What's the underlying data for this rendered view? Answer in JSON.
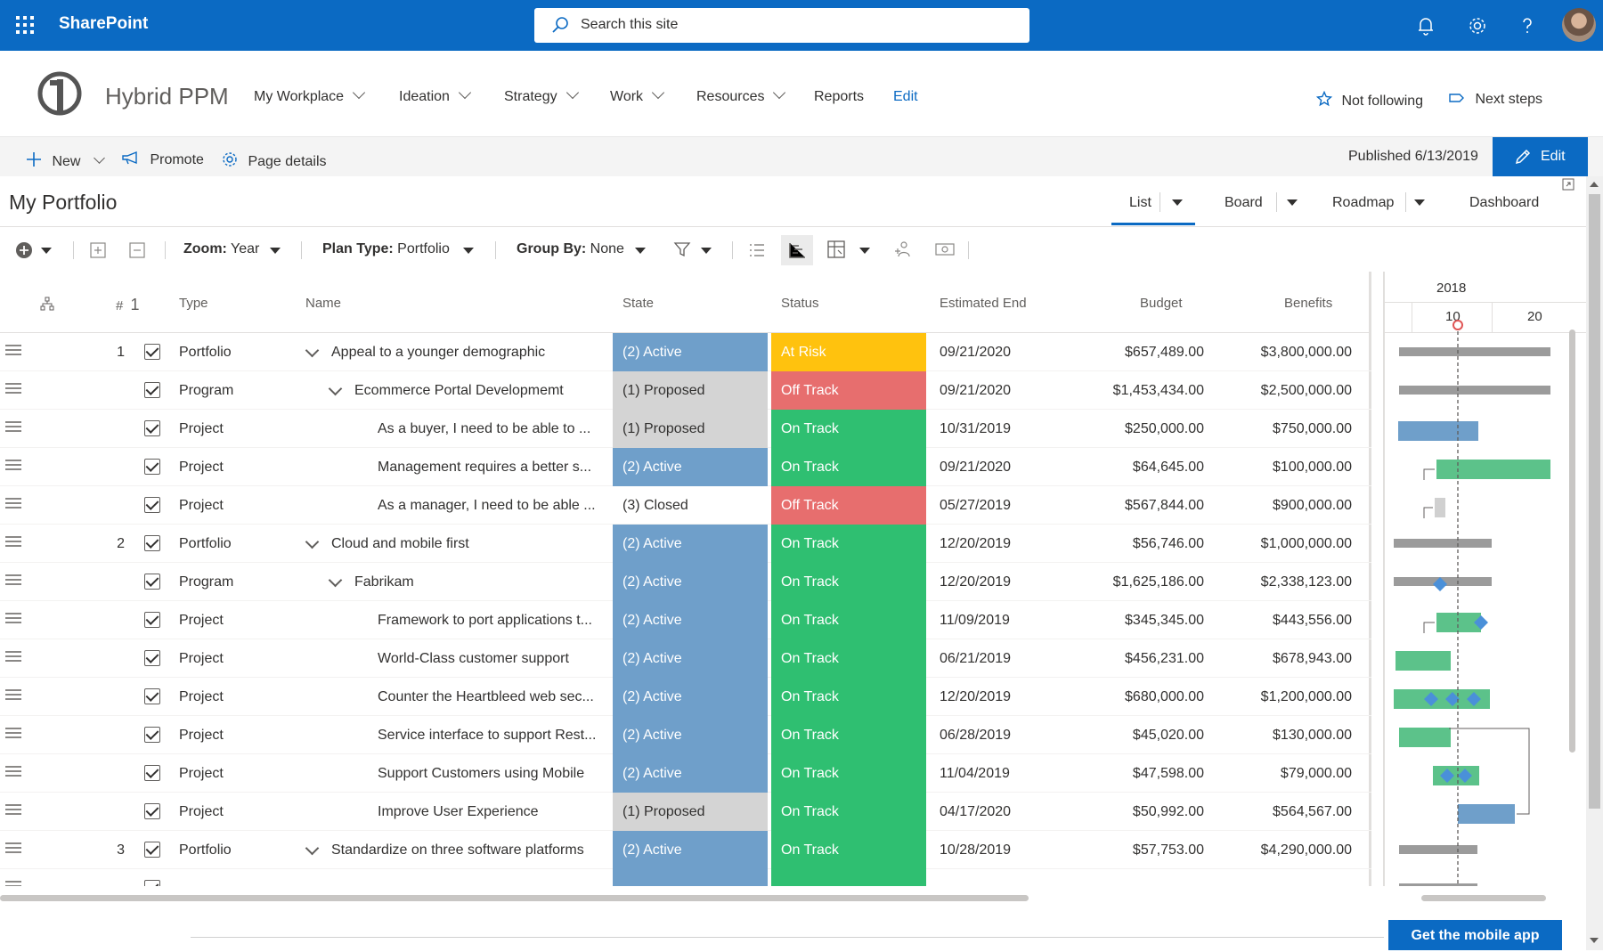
{
  "suitebar": {
    "brand": "SharePoint",
    "search_placeholder": "Search this site"
  },
  "site": {
    "title": "Hybrid PPM",
    "nav": [
      "My Workplace",
      "Ideation",
      "Strategy",
      "Work",
      "Resources",
      "Reports",
      "Edit"
    ],
    "not_following": "Not following",
    "next_steps": "Next steps"
  },
  "commandbar": {
    "new": "New",
    "promote": "Promote",
    "page_details": "Page details",
    "published": "Published 6/13/2019",
    "edit": "Edit"
  },
  "portfolio": {
    "title": "My Portfolio",
    "views": [
      "List",
      "Board",
      "Roadmap",
      "Dashboard"
    ],
    "active_view": "List"
  },
  "toolbar": {
    "zoom_label": "Zoom:",
    "zoom_value": "Year",
    "plan_label": "Plan Type:",
    "plan_value": "Portfolio",
    "group_label": "Group By:",
    "group_value": "None"
  },
  "columns": {
    "num": "#",
    "num_sort": "1",
    "type": "Type",
    "name": "Name",
    "state": "State",
    "status": "Status",
    "end": "Estimated End",
    "budget": "Budget",
    "benefits": "Benefits"
  },
  "colors": {
    "active": "#6f9fca",
    "proposed": "#d4d4d4",
    "at_risk": "#ffc20e",
    "off_track": "#e76e6e",
    "on_track": "#2fbf71",
    "bar_grey": "#9b9b9b",
    "bar_blue": "#6f9fca",
    "bar_green": "#5cc28a",
    "milestone": "#4a90d9"
  },
  "rows": [
    {
      "num": "1",
      "type": "Portfolio",
      "name": "Appeal to a younger demographic",
      "state": "(2) Active",
      "status": "At Risk",
      "end": "09/21/2020",
      "budget": "$657,489.00",
      "benefits": "$3,800,000.00"
    },
    {
      "num": "",
      "type": "Program",
      "name": "Ecommerce Portal Developmemt",
      "state": "(1) Proposed",
      "status": "Off Track",
      "end": "09/21/2020",
      "budget": "$1,453,434.00",
      "benefits": "$2,500,000.00"
    },
    {
      "num": "",
      "type": "Project",
      "name": "As a buyer, I need to be able to ...",
      "state": "(1) Proposed",
      "status": "On Track",
      "end": "10/31/2019",
      "budget": "$250,000.00",
      "benefits": "$750,000.00"
    },
    {
      "num": "",
      "type": "Project",
      "name": "Management requires a better s...",
      "state": "(2) Active",
      "status": "On Track",
      "end": "09/21/2020",
      "budget": "$64,645.00",
      "benefits": "$100,000.00"
    },
    {
      "num": "",
      "type": "Project",
      "name": "As a manager, I need to be able ...",
      "state": "(3) Closed",
      "status": "Off Track",
      "end": "05/27/2019",
      "budget": "$567,844.00",
      "benefits": "$900,000.00"
    },
    {
      "num": "2",
      "type": "Portfolio",
      "name": "Cloud and mobile first",
      "state": "(2) Active",
      "status": "On Track",
      "end": "12/20/2019",
      "budget": "$56,746.00",
      "benefits": "$1,000,000.00"
    },
    {
      "num": "",
      "type": "Program",
      "name": "Fabrikam",
      "state": "(2) Active",
      "status": "On Track",
      "end": "12/20/2019",
      "budget": "$1,625,186.00",
      "benefits": "$2,338,123.00"
    },
    {
      "num": "",
      "type": "Project",
      "name": "Framework to port applications t...",
      "state": "(2) Active",
      "status": "On Track",
      "end": "11/09/2019",
      "budget": "$345,345.00",
      "benefits": "$443,556.00"
    },
    {
      "num": "",
      "type": "Project",
      "name": "World-Class customer support",
      "state": "(2) Active",
      "status": "On Track",
      "end": "06/21/2019",
      "budget": "$456,231.00",
      "benefits": "$678,943.00"
    },
    {
      "num": "",
      "type": "Project",
      "name": "Counter the Heartbleed web sec...",
      "state": "(2) Active",
      "status": "On Track",
      "end": "12/20/2019",
      "budget": "$680,000.00",
      "benefits": "$1,200,000.00"
    },
    {
      "num": "",
      "type": "Project",
      "name": "Service interface to support Rest...",
      "state": "(2) Active",
      "status": "On Track",
      "end": "06/28/2019",
      "budget": "$45,020.00",
      "benefits": "$130,000.00"
    },
    {
      "num": "",
      "type": "Project",
      "name": "Support Customers using Mobile",
      "state": "(2) Active",
      "status": "On Track",
      "end": "11/04/2019",
      "budget": "$47,598.00",
      "benefits": "$79,000.00"
    },
    {
      "num": "",
      "type": "Project",
      "name": "Improve User Experience",
      "state": "(1) Proposed",
      "status": "On Track",
      "end": "04/17/2020",
      "budget": "$50,992.00",
      "benefits": "$564,567.00"
    },
    {
      "num": "3",
      "type": "Portfolio",
      "name": "Standardize on three software platforms",
      "state": "(2) Active",
      "status": "On Track",
      "end": "10/28/2019",
      "budget": "$57,753.00",
      "benefits": "$4,290,000.00"
    }
  ],
  "gantt": {
    "year": "2018",
    "months": [
      "10",
      "20"
    ]
  },
  "footer": {
    "mobile": "Get the mobile app"
  }
}
